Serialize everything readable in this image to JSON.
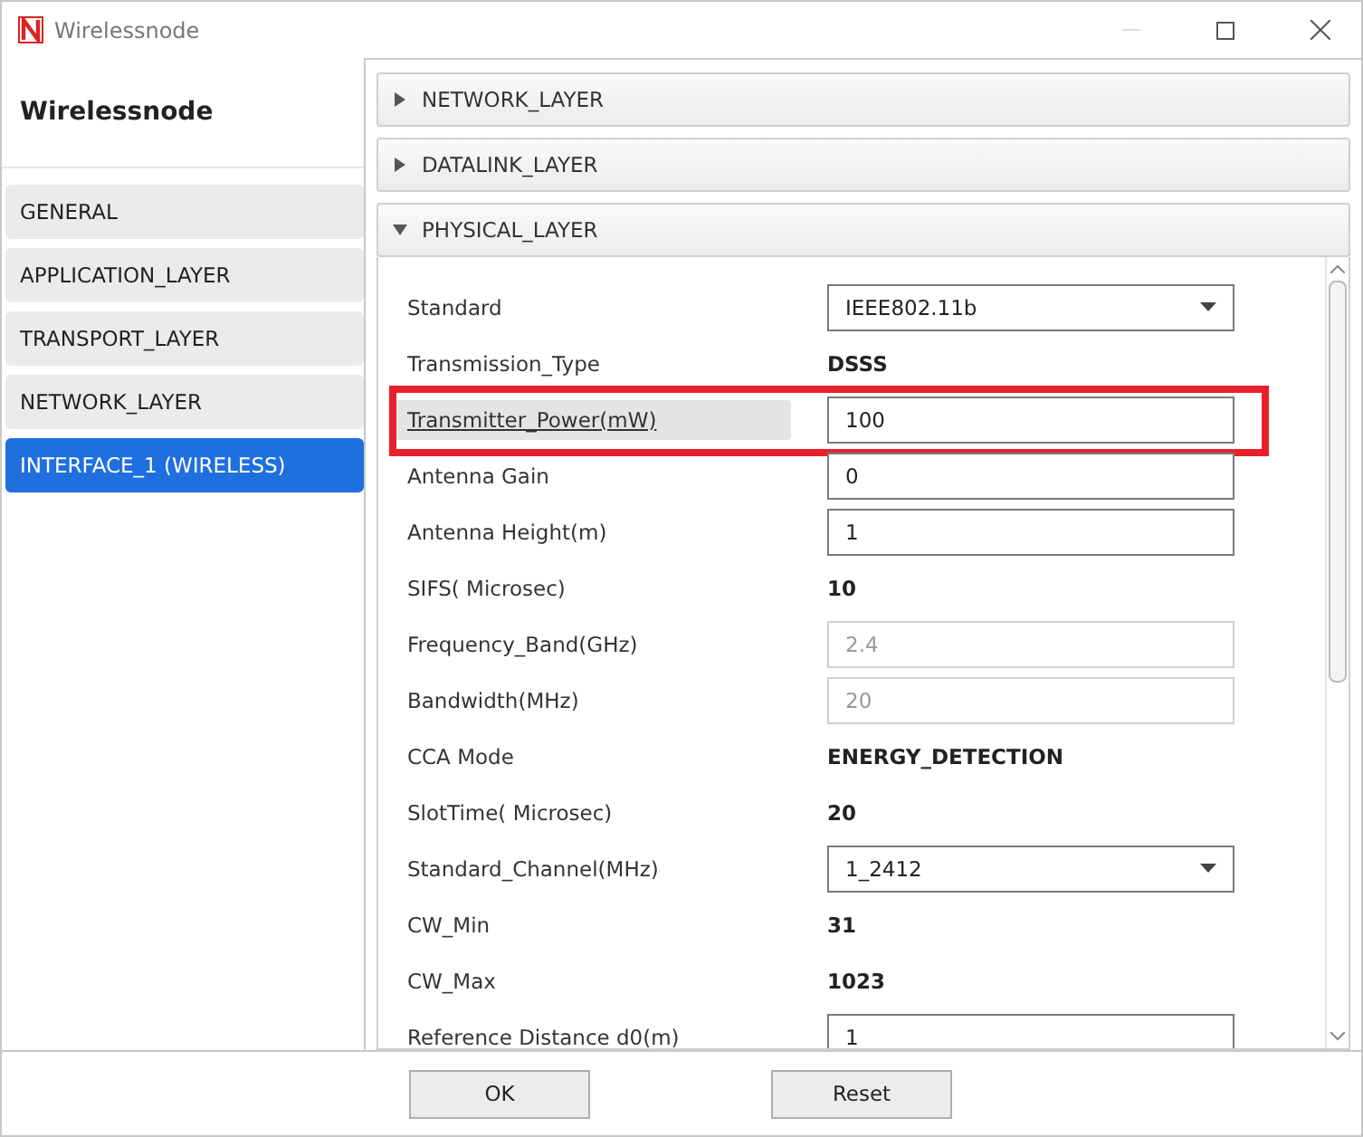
{
  "window": {
    "title": "Wirelessnode"
  },
  "sidebar": {
    "heading": "Wirelessnode",
    "items": [
      {
        "label": "GENERAL",
        "selected": false
      },
      {
        "label": "APPLICATION_LAYER",
        "selected": false
      },
      {
        "label": "TRANSPORT_LAYER",
        "selected": false
      },
      {
        "label": "NETWORK_LAYER",
        "selected": false
      },
      {
        "label": "INTERFACE_1 (WIRELESS)",
        "selected": true
      }
    ]
  },
  "sections": [
    {
      "label": "NETWORK_LAYER",
      "expanded": false
    },
    {
      "label": "DATALINK_LAYER",
      "expanded": false
    },
    {
      "label": "PHYSICAL_LAYER",
      "expanded": true
    }
  ],
  "properties": [
    {
      "label": "Standard",
      "kind": "select",
      "value": "IEEE802.11b",
      "highlighted": false
    },
    {
      "label": "Transmission_Type",
      "kind": "fixed",
      "value": "DSSS",
      "highlighted": false
    },
    {
      "label": "Transmitter_Power(mW)",
      "kind": "input",
      "value": "100",
      "highlighted": true
    },
    {
      "label": "Antenna Gain",
      "kind": "input",
      "value": "0",
      "highlighted": false
    },
    {
      "label": "Antenna Height(m)",
      "kind": "input",
      "value": "1",
      "highlighted": false
    },
    {
      "label": "SIFS( Microsec)",
      "kind": "fixed",
      "value": "10",
      "highlighted": false
    },
    {
      "label": "Frequency_Band(GHz)",
      "kind": "disabled",
      "value": "2.4",
      "highlighted": false
    },
    {
      "label": "Bandwidth(MHz)",
      "kind": "disabled",
      "value": "20",
      "highlighted": false
    },
    {
      "label": "CCA Mode",
      "kind": "fixed",
      "value": "ENERGY_DETECTION",
      "highlighted": false
    },
    {
      "label": "SlotTime( Microsec)",
      "kind": "fixed",
      "value": "20",
      "highlighted": false
    },
    {
      "label": "Standard_Channel(MHz)",
      "kind": "select",
      "value": "1_2412",
      "highlighted": false
    },
    {
      "label": "CW_Min",
      "kind": "fixed",
      "value": "31",
      "highlighted": false
    },
    {
      "label": "CW_Max",
      "kind": "fixed",
      "value": "1023",
      "highlighted": false
    },
    {
      "label": "Reference Distance d0(m)",
      "kind": "input",
      "value": "1",
      "highlighted": false
    }
  ],
  "buttons": [
    {
      "label": "OK"
    },
    {
      "label": "Reset"
    }
  ]
}
